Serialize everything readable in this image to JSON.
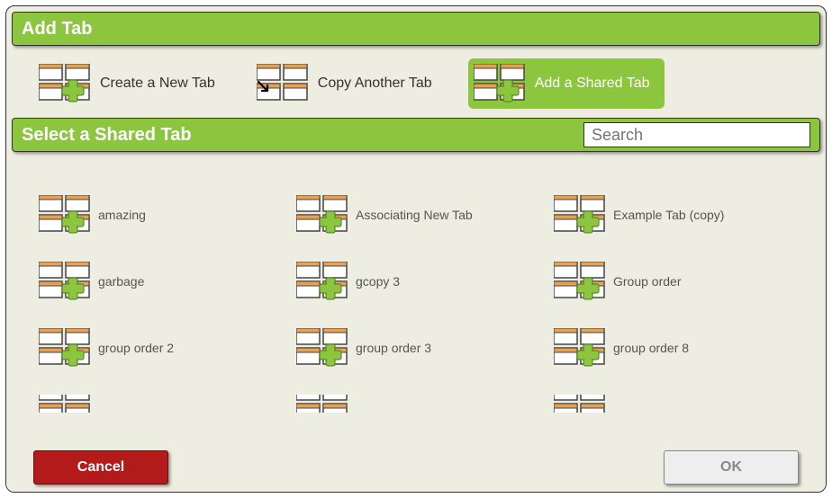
{
  "header": {
    "title": "Add Tab"
  },
  "options": {
    "create": {
      "label": "Create a New Tab",
      "selected": false
    },
    "copy": {
      "label": "Copy Another Tab",
      "selected": false
    },
    "shared": {
      "label": "Add a Shared Tab",
      "selected": true
    }
  },
  "section": {
    "title": "Select a Shared Tab",
    "search_placeholder": "Search"
  },
  "tabs": [
    {
      "label": "amazing"
    },
    {
      "label": "Associating New Tab"
    },
    {
      "label": "Example Tab (copy)"
    },
    {
      "label": "garbage"
    },
    {
      "label": "gcopy 3"
    },
    {
      "label": "Group order"
    },
    {
      "label": "group order 2"
    },
    {
      "label": "group order 3"
    },
    {
      "label": "group order 8"
    }
  ],
  "footer": {
    "cancel": "Cancel",
    "ok": "OK"
  }
}
